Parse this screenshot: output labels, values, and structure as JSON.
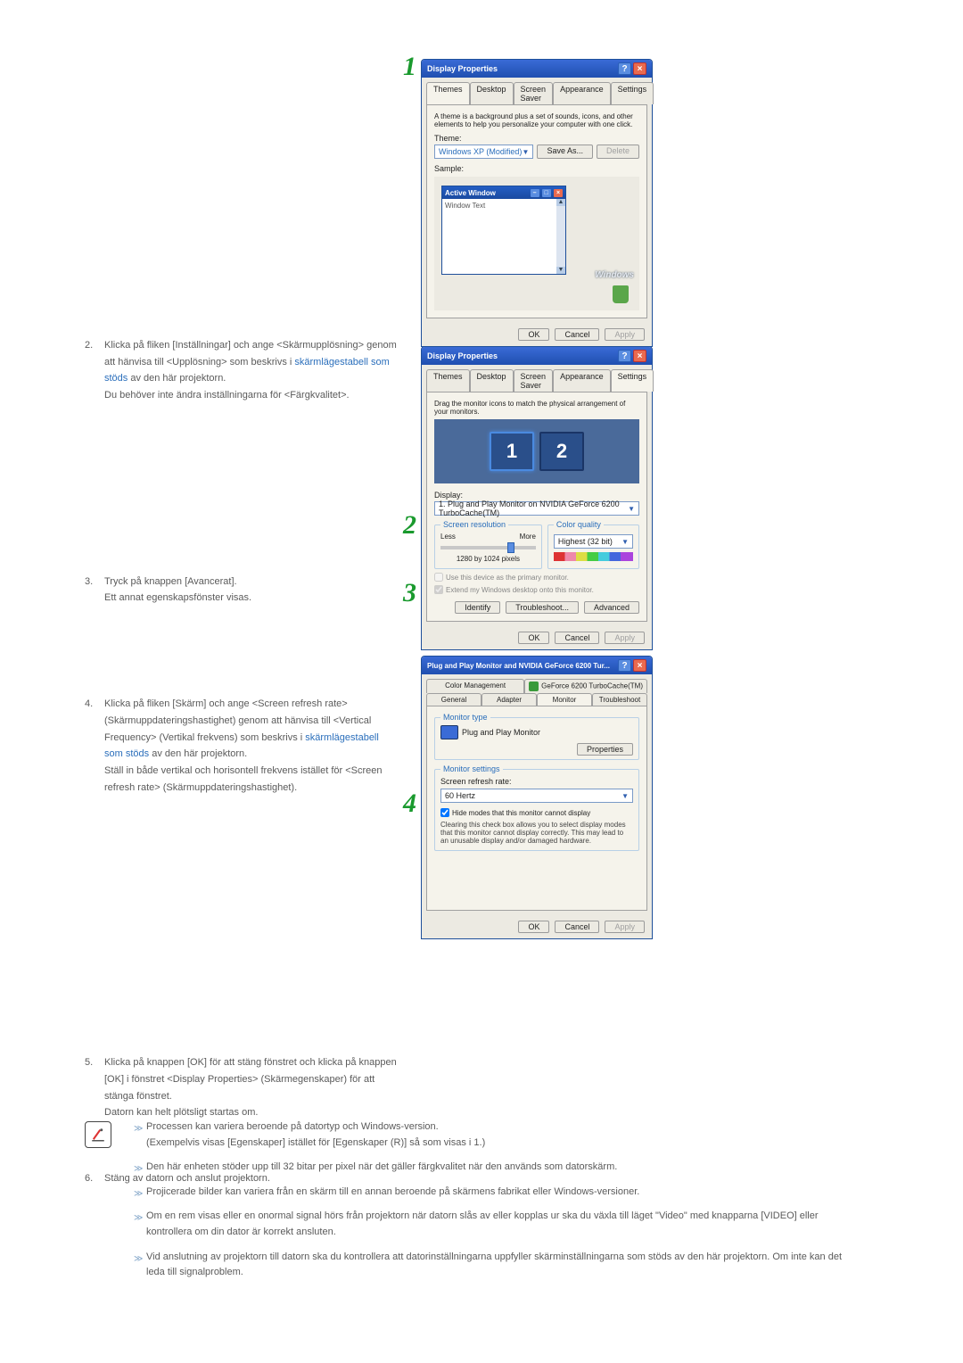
{
  "steps": {
    "s2": {
      "num": "2.",
      "line1": "Klicka på fliken [Inställningar] och ange <Skärmupplösning> genom att hänvisa till <Upplösning> som beskrivs i ",
      "link": "skärmlägestabell som stöds",
      "line2": " av den här projektorn.",
      "line3": "Du behöver inte ändra inställningarna för <Färgkvalitet>."
    },
    "s3": {
      "num": "3.",
      "line1": "Tryck på knappen [Avancerat].",
      "line2": "Ett annat egenskapsfönster visas."
    },
    "s4": {
      "num": "4.",
      "line1": "Klicka på fliken [Skärm] och ange <Screen refresh rate> (Skärmuppdateringshastighet) genom att hänvisa till <Vertical Frequency> (Vertikal frekvens) som beskrivs i ",
      "link": "skärmlägestabell som stöds",
      "line2": " av den här projektorn.",
      "line3": "Ställ in både vertikal och horisontell frekvens istället för <Screen refresh rate> (Skärmuppdateringshastighet)."
    },
    "s5": {
      "num": "5.",
      "line1": "Klicka på knappen [OK] för att stäng fönstret och klicka på knappen [OK] i fönstret <Display Properties> (Skärmegenskaper) för att stänga fönstret.",
      "line2": "Datorn kan helt plötsligt startas om."
    },
    "s6": {
      "num": "6.",
      "line1": "Stäng av datorn och anslut projektorn."
    }
  },
  "notes": {
    "n1": "Processen kan variera beroende på datortyp och Windows-version.",
    "n1b": "(Exempelvis visas [Egenskaper] istället för [Egenskaper (R)] så som visas i 1.)",
    "n2": "Den här enheten stöder upp till 32 bitar per pixel när det gäller färgkvalitet när den används som datorskärm.",
    "n3": "Projicerade bilder kan variera från en skärm till en annan beroende på skärmens fabrikat eller Windows-versioner.",
    "n4": "Om en rem visas eller en onormal signal hörs från projektorn när datorn slås av eller kopplas ur ska du växla till läget \"Video\" med knapparna [VIDEO] eller kontrollera om din dator är korrekt ansluten.",
    "n5": "Vid anslutning av projektorn till datorn ska du kontrollera att datorinställningarna uppfyller skärminställningarna som stöds av den här projektorn. Om inte kan det leda till signalproblem."
  },
  "numerals": {
    "n1": "1",
    "n2": "2",
    "n3": "3",
    "n4": "4"
  },
  "dlg1": {
    "title": "Display Properties",
    "tabs": [
      "Themes",
      "Desktop",
      "Screen Saver",
      "Appearance",
      "Settings"
    ],
    "desc": "A theme is a background plus a set of sounds, icons, and other elements to help you personalize your computer with one click.",
    "theme_label": "Theme:",
    "theme_value": "Windows XP (Modified)",
    "save_as": "Save As...",
    "delete": "Delete",
    "sample_label": "Sample:",
    "active_window": "Active Window",
    "window_text": "Window Text",
    "windows_logo": "Windows",
    "ok": "OK",
    "cancel": "Cancel",
    "apply": "Apply"
  },
  "dlg2": {
    "title": "Display Properties",
    "tabs": [
      "Themes",
      "Desktop",
      "Screen Saver",
      "Appearance",
      "Settings"
    ],
    "drag": "Drag the monitor icons to match the physical arrangement of your monitors.",
    "disp_label": "Display:",
    "disp_value": "1. Plug and Play Monitor on NVIDIA GeForce 6200 TurboCache(TM)",
    "res_legend": "Screen resolution",
    "less": "Less",
    "more": "More",
    "res_value": "1280 by 1024 pixels",
    "cq_legend": "Color quality",
    "cq_value": "Highest (32 bit)",
    "chk1": "Use this device as the primary monitor.",
    "chk2": "Extend my Windows desktop onto this monitor.",
    "identify": "Identify",
    "troubleshoot": "Troubleshoot...",
    "advanced": "Advanced",
    "ok": "OK",
    "cancel": "Cancel",
    "apply": "Apply",
    "m1": "1",
    "m2": "2"
  },
  "dlg3": {
    "title": "Plug and Play Monitor and NVIDIA GeForce 6200 Tur...",
    "tabs_row1": [
      "Color Management",
      "GeForce 6200 TurboCache(TM)"
    ],
    "tabs_row2": [
      "General",
      "Adapter",
      "Monitor",
      "Troubleshoot"
    ],
    "mt_legend": "Monitor type",
    "mt_value": "Plug and Play Monitor",
    "properties": "Properties",
    "ms_legend": "Monitor settings",
    "refresh_label": "Screen refresh rate:",
    "refresh_value": "60 Hertz",
    "hide_chk": "Hide modes that this monitor cannot display",
    "hide_text": "Clearing this check box allows you to select display modes that this monitor cannot display correctly. This may lead to an unusable display and/or damaged hardware.",
    "ok": "OK",
    "cancel": "Cancel",
    "apply": "Apply"
  }
}
